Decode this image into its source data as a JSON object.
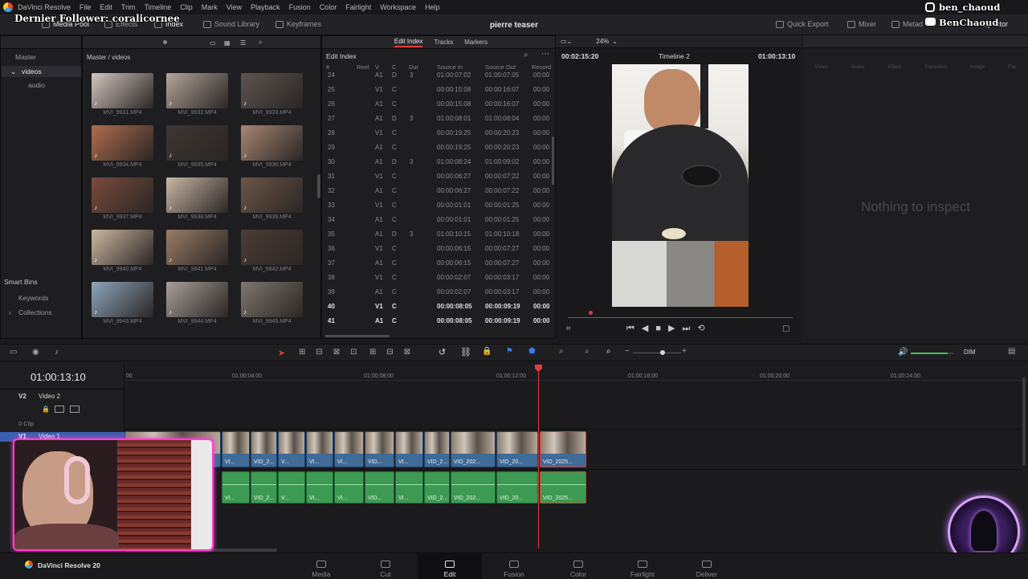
{
  "menubar": {
    "items": [
      "DaVinci Resolve",
      "File",
      "Edit",
      "Trim",
      "Timeline",
      "Clip",
      "Mark",
      "View",
      "Playback",
      "Fusion",
      "Color",
      "Fairlight",
      "Workspace",
      "Help"
    ]
  },
  "toolbar": {
    "media_pool": "Media Pool",
    "effects": "Effects",
    "index": "Index",
    "sound_library": "Sound Library",
    "keyframes": "Keyframes",
    "project_title": "pierre teaser",
    "quick_export": "Quick Export",
    "mixer": "Mixer",
    "metadata": "Metad",
    "inspector": "Inspector"
  },
  "overlay": {
    "follower_banner": "Dernier Follower: coralicornee",
    "instagram": "ben_chaoud",
    "youtube": "BenChaoud"
  },
  "media_pool": {
    "root": "Master",
    "bins": [
      "videos",
      "audio"
    ],
    "smart_bins_title": "Smart Bins",
    "smart_bins": [
      "Keywords",
      "Collections"
    ],
    "path": "Master / videos",
    "clips": [
      "MVI_9931.MP4",
      "MVI_9932.MP4",
      "MVI_9933.MP4",
      "MVI_9934.MP4",
      "MVI_9935.MP4",
      "MVI_9936.MP4",
      "MVI_9937.MP4",
      "MVI_9938.MP4",
      "MVI_9939.MP4",
      "MVI_9940.MP4",
      "MVI_9941.MP4",
      "MVI_9942.MP4",
      "MVI_9943.MP4",
      "MVI_9944.MP4",
      "MVI_9945.MP4"
    ]
  },
  "edit_index": {
    "tabs": [
      "Edit Index",
      "Tracks",
      "Markers"
    ],
    "title": "Edit Index",
    "columns": [
      "#",
      "Reel",
      "V",
      "C",
      "Dur",
      "Source In",
      "Source Out",
      "Record"
    ],
    "rows": [
      {
        "n": "24",
        "v": "A1",
        "c": "D",
        "dur": "3",
        "src_in": "01:00:07:02",
        "src_out": "01:00:07:05",
        "rec": "00:00"
      },
      {
        "n": "25",
        "v": "V1",
        "c": "C",
        "dur": "",
        "src_in": "00:00:15:08",
        "src_out": "00:00:16:07",
        "rec": "00:00"
      },
      {
        "n": "26",
        "v": "A1",
        "c": "C",
        "dur": "",
        "src_in": "00:00:15:08",
        "src_out": "00:00:16:07",
        "rec": "00:00"
      },
      {
        "n": "27",
        "v": "A1",
        "c": "D",
        "dur": "3",
        "src_in": "01:00:08:01",
        "src_out": "01:00:08:04",
        "rec": "00:00"
      },
      {
        "n": "28",
        "v": "V1",
        "c": "C",
        "dur": "",
        "src_in": "00:00:19:25",
        "src_out": "00:00:20:23",
        "rec": "00:00"
      },
      {
        "n": "29",
        "v": "A1",
        "c": "C",
        "dur": "",
        "src_in": "00:00:19:25",
        "src_out": "00:00:20:23",
        "rec": "00:00"
      },
      {
        "n": "30",
        "v": "A1",
        "c": "D",
        "dur": "3",
        "src_in": "01:00:08:24",
        "src_out": "01:00:09:02",
        "rec": "00:00"
      },
      {
        "n": "31",
        "v": "V1",
        "c": "C",
        "dur": "",
        "src_in": "00:00:06:27",
        "src_out": "00:00:07:22",
        "rec": "00:00"
      },
      {
        "n": "32",
        "v": "A1",
        "c": "C",
        "dur": "",
        "src_in": "00:00:06:27",
        "src_out": "00:00:07:22",
        "rec": "00:00"
      },
      {
        "n": "33",
        "v": "V1",
        "c": "C",
        "dur": "",
        "src_in": "00:00:01:01",
        "src_out": "00:00:01:25",
        "rec": "00:00"
      },
      {
        "n": "34",
        "v": "A1",
        "c": "C",
        "dur": "",
        "src_in": "00:00:01:01",
        "src_out": "00:00:01:25",
        "rec": "00:00"
      },
      {
        "n": "35",
        "v": "A1",
        "c": "D",
        "dur": "3",
        "src_in": "01:00:10:15",
        "src_out": "01:00:10:18",
        "rec": "00:00"
      },
      {
        "n": "36",
        "v": "V1",
        "c": "C",
        "dur": "",
        "src_in": "00:00:06:15",
        "src_out": "00:00:07:27",
        "rec": "00:00"
      },
      {
        "n": "37",
        "v": "A1",
        "c": "C",
        "dur": "",
        "src_in": "00:00:06:15",
        "src_out": "00:00:07:27",
        "rec": "00:00"
      },
      {
        "n": "38",
        "v": "V1",
        "c": "C",
        "dur": "",
        "src_in": "00:00:02:07",
        "src_out": "00:00:03:17",
        "rec": "00:00"
      },
      {
        "n": "39",
        "v": "A1",
        "c": "C",
        "dur": "",
        "src_in": "00:00:02:07",
        "src_out": "00:00:03:17",
        "rec": "00:00"
      },
      {
        "n": "40",
        "v": "V1",
        "c": "C",
        "dur": "",
        "src_in": "00:00:08:05",
        "src_out": "00:00:09:19",
        "rec": "00:00",
        "bold": true
      },
      {
        "n": "41",
        "v": "A1",
        "c": "C",
        "dur": "",
        "src_in": "00:00:08:05",
        "src_out": "00:00:09:19",
        "rec": "00:00",
        "bold": true
      }
    ]
  },
  "viewer": {
    "zoom": "24%",
    "source_tc": "00:02:15:20",
    "timeline_name": "Timeline 2",
    "record_tc": "01:00:13:10",
    "playhead_position": 0.1
  },
  "inspector": {
    "tabs": [
      "Video",
      "Audio",
      "Effect",
      "Transition",
      "Image",
      "File"
    ],
    "empty_message": "Nothing to inspect"
  },
  "timeline": {
    "timecode": "01:00:13:10",
    "ruler": [
      "01:00:04:00",
      "01:00:08:00",
      "01:00:12:00",
      "01:00:16:00",
      "01:00:20:00",
      "01:00:24:00"
    ],
    "ruler_first": "00",
    "tracks": [
      {
        "id": "V2",
        "name": "Video 2",
        "clips": "0 Clip"
      },
      {
        "id": "V1",
        "name": "Video 1"
      }
    ],
    "video_clips": [
      "VI...",
      "VID_2...",
      "V...",
      "VI...",
      "VI...",
      "VID...",
      "VI...",
      "VID_2...",
      "VID_202...",
      "VID_20...",
      "VID_2025..."
    ],
    "audio_clips": [
      "VI...",
      "VID_2...",
      "V...",
      "VI...",
      "VI...",
      "VID...",
      "VI...",
      "VID_2...",
      "VID_202...",
      "VID_20...",
      "VID_2025..."
    ],
    "dim_label": "DIM",
    "volume": 0.85
  },
  "bottom_nav": {
    "app": "DaVinci Resolve 20",
    "pages": [
      "Media",
      "Cut",
      "Edit",
      "Fusion",
      "Color",
      "Fairlight",
      "Deliver"
    ],
    "active": "Edit"
  },
  "colors": {
    "accent": "#e23b3b",
    "video_clip": "#3f6b96",
    "audio_clip": "#3c9a53",
    "stream_frame": "#ff3fd0"
  }
}
